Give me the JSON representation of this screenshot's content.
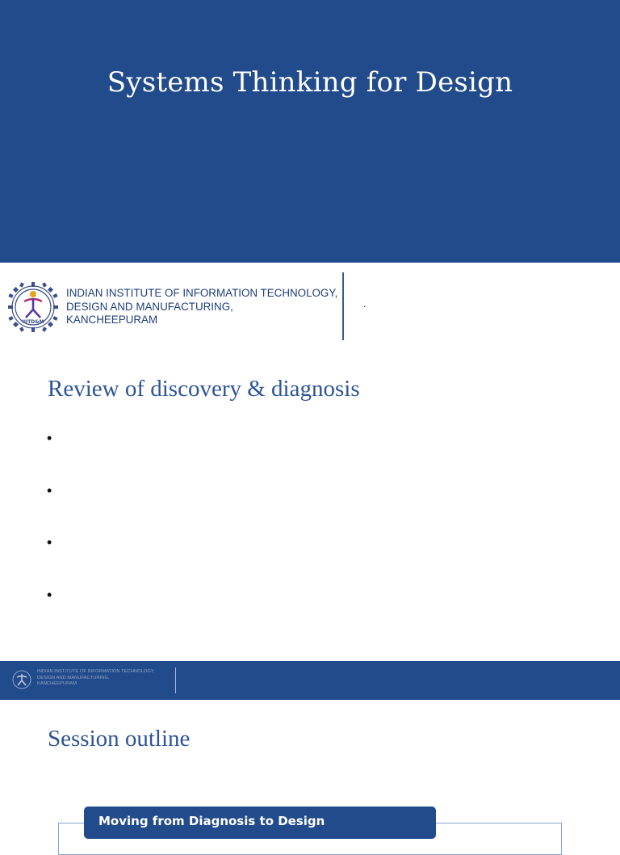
{
  "deck": {
    "title": "Systems Thinking for Design"
  },
  "institute": {
    "lines": [
      "INDIAN INSTITUTE OF INFORMATION TECHNOLOGY,",
      "DESIGN AND MANUFACTURING,",
      "KANCHEEPURAM"
    ],
    "logo_text": "IIITD&M",
    "logo_icon": "institute-gear-logo"
  },
  "slide_review": {
    "header_mark": ".",
    "heading": "Review of discovery & diagnosis",
    "bullets": [
      "•",
      "•",
      "•",
      "•"
    ]
  },
  "slide_outline": {
    "heading": "Session outline",
    "box_label": "Moving from Diagnosis to Design"
  },
  "colors": {
    "brand_blue": "#224b8c",
    "heading_blue": "#2c5497",
    "institute_text": "#1f3f7a",
    "white": "#ffffff"
  }
}
